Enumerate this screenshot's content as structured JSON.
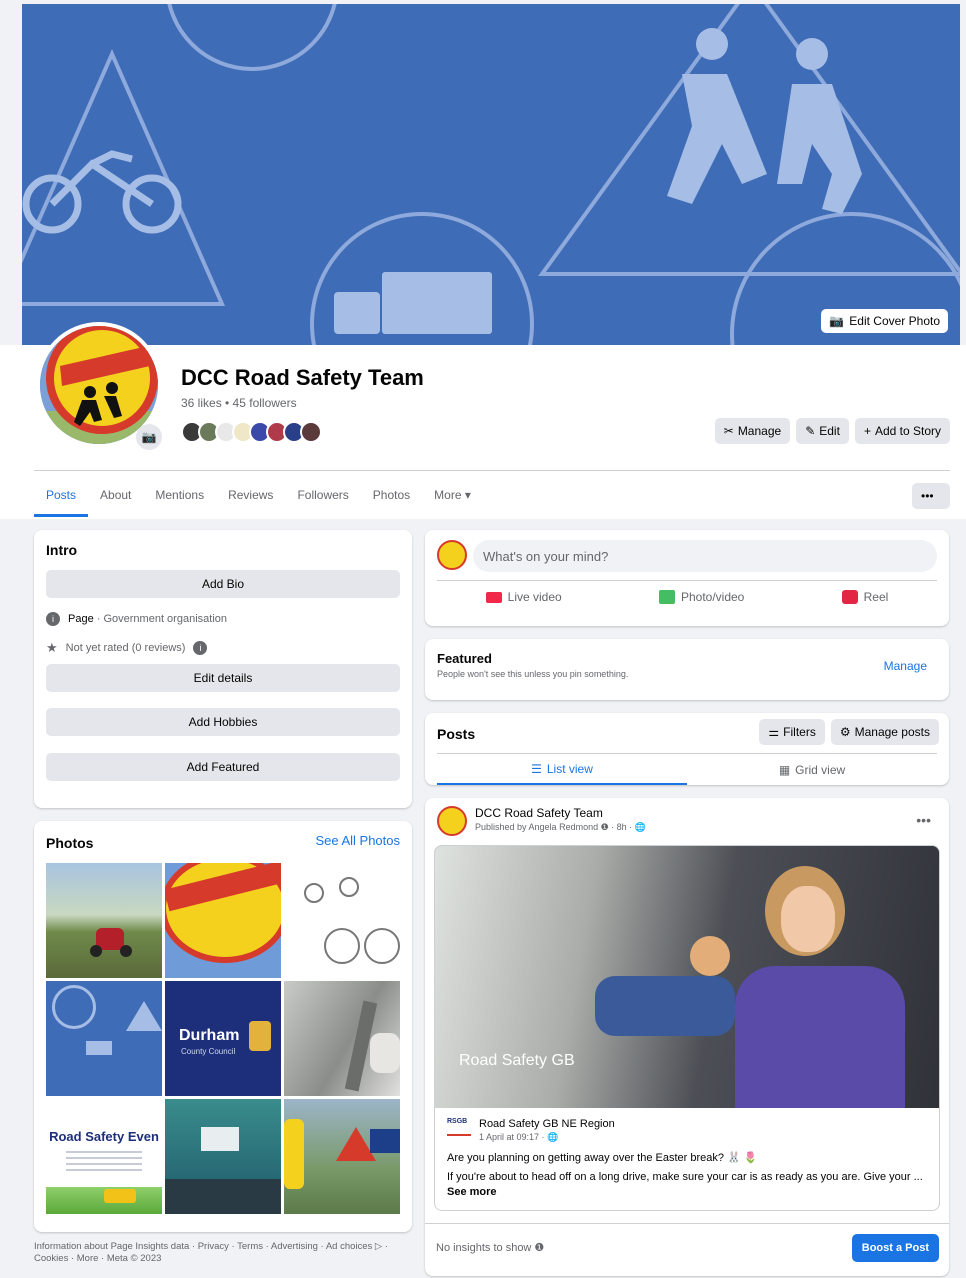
{
  "cover": {
    "edit_label": "Edit Cover Photo"
  },
  "page": {
    "title": "DCC Road Safety Team",
    "stats": "36 likes • 45 followers"
  },
  "header_actions": {
    "manage": "Manage",
    "edit": "Edit",
    "add_story": "Add to Story"
  },
  "tabs": [
    "Posts",
    "About",
    "Mentions",
    "Reviews",
    "Followers",
    "Photos",
    "More ▾"
  ],
  "intro": {
    "title": "Intro",
    "add_bio": "Add Bio",
    "page_label": "Page",
    "page_category": " · Government organisation",
    "rating": "Not yet rated (0 reviews)",
    "edit_details": "Edit details",
    "add_hobbies": "Add Hobbies",
    "add_featured": "Add Featured"
  },
  "photos": {
    "title": "Photos",
    "see_all": "See All Photos",
    "durham_logo": "Durham",
    "durham_sub": "County Council",
    "event_title": "Road Safety Even"
  },
  "footer": {
    "text": "Information about Page Insights data · Privacy · Terms · Advertising · Ad choices ▷ · Cookies · More · Meta © 2023"
  },
  "composer": {
    "placeholder": "What's on your mind?",
    "live": "Live video",
    "photo": "Photo/video",
    "reel": "Reel"
  },
  "featured": {
    "title": "Featured",
    "subtitle": "People won't see this unless you pin something.",
    "manage": "Manage"
  },
  "posts_section": {
    "title": "Posts",
    "filters": "Filters",
    "manage_posts": "Manage posts",
    "list_view": "List view",
    "grid_view": "Grid view"
  },
  "post": {
    "author": "DCC Road Safety Team",
    "meta": "Published by Angela Redmond ❶ · 8h · 🌐",
    "shared_author": "Road Safety GB NE Region",
    "shared_meta": "1 April at 09:17 · 🌐",
    "image_watermark": "Road Safety GB",
    "line1": "Are you planning on getting away over the Easter break? 🐰 🌷",
    "line2": "If you're about to head off on a long drive, make sure your car is as ready as you are.  Give your ...",
    "see_more": "See more",
    "insights": "No insights to show ❶",
    "boost": "Boost a Post"
  },
  "colors": {
    "accent": "#1b74e4",
    "cover": "#3f6cb6"
  }
}
